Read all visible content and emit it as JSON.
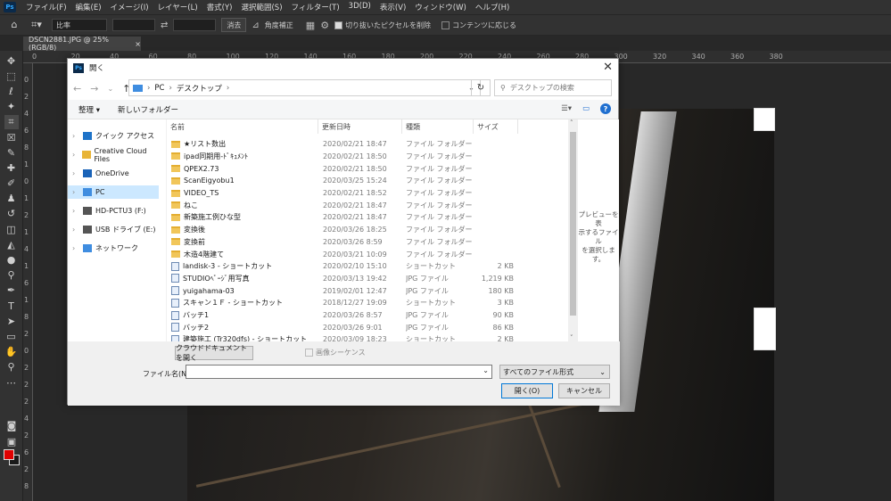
{
  "menu": [
    "ファイル(F)",
    "編集(E)",
    "イメージ(I)",
    "レイヤー(L)",
    "書式(Y)",
    "選択範囲(S)",
    "フィルター(T)",
    "3D(D)",
    "表示(V)",
    "ウィンドウ(W)",
    "ヘルプ(H)"
  ],
  "app_logo": "Ps",
  "options": {
    "ratio": "比率",
    "clear": "消去",
    "straighten": "角度補正",
    "delete_cropped": "切り抜いたピクセルを削除",
    "content_aware": "コンテンツに応じる"
  },
  "doc_tab": {
    "title": "DSCN2881.JPG @ 25% (RGB/8)",
    "close": "×"
  },
  "ruler_top": [
    "0",
    "20",
    "40",
    "60",
    "80",
    "100",
    "120",
    "140",
    "160",
    "180",
    "200",
    "220",
    "240",
    "260",
    "280",
    "300",
    "320",
    "340",
    "360",
    "380"
  ],
  "ruler_left": [
    "0",
    "2",
    "4",
    "6",
    "8",
    "1",
    "0",
    "1",
    "2",
    "1",
    "4",
    "1",
    "6",
    "1",
    "8",
    "2",
    "0",
    "2",
    "2",
    "2",
    "4",
    "2",
    "6",
    "2",
    "8"
  ],
  "dialog": {
    "title": "開く",
    "close": "✕",
    "address": [
      "PC",
      "デスクトップ"
    ],
    "search_placeholder": "デスクトップの検索",
    "organize": "整理 ▾",
    "new_folder": "新しいフォルダー",
    "nav": [
      {
        "label": "クイック アクセス",
        "icon": "star-icon",
        "color": "#1e73c8"
      },
      {
        "label": "Creative Cloud Files",
        "icon": "cloud-folder-icon",
        "color": "#e8b437"
      },
      {
        "label": "OneDrive",
        "icon": "onedrive-icon",
        "color": "#1a63b8"
      },
      {
        "label": "PC",
        "icon": "pc-icon",
        "color": "#3f8de0"
      },
      {
        "label": "HD-PCTU3 (F:)",
        "icon": "drive-icon",
        "color": "#555555"
      },
      {
        "label": "USB ドライブ (E:)",
        "icon": "usb-drive-icon",
        "color": "#555555"
      },
      {
        "label": "ネットワーク",
        "icon": "network-icon",
        "color": "#3f8de0"
      }
    ],
    "columns": {
      "name": "名前",
      "date": "更新日時",
      "type": "種類",
      "size": "サイズ"
    },
    "files": [
      {
        "name": "★リスト数出",
        "date": "2020/02/21 18:47",
        "type": "ファイル フォルダー",
        "size": "",
        "kind": "folder"
      },
      {
        "name": "ipad同期用-ﾄﾞｷｭﾒﾝﾄ",
        "date": "2020/02/21 18:50",
        "type": "ファイル フォルダー",
        "size": "",
        "kind": "folder"
      },
      {
        "name": "QPEX2.73",
        "date": "2020/02/21 18:50",
        "type": "ファイル フォルダー",
        "size": "",
        "kind": "folder"
      },
      {
        "name": "ScanEigyobu1",
        "date": "2020/03/25 15:24",
        "type": "ファイル フォルダー",
        "size": "",
        "kind": "folder"
      },
      {
        "name": "VIDEO_TS",
        "date": "2020/02/21 18:52",
        "type": "ファイル フォルダー",
        "size": "",
        "kind": "folder"
      },
      {
        "name": "ねこ",
        "date": "2020/02/21 18:47",
        "type": "ファイル フォルダー",
        "size": "",
        "kind": "folder"
      },
      {
        "name": "新築施工例ひな型",
        "date": "2020/02/21 18:47",
        "type": "ファイル フォルダー",
        "size": "",
        "kind": "folder"
      },
      {
        "name": "変換後",
        "date": "2020/03/26 18:25",
        "type": "ファイル フォルダー",
        "size": "",
        "kind": "folder"
      },
      {
        "name": "変換前",
        "date": "2020/03/26 8:59",
        "type": "ファイル フォルダー",
        "size": "",
        "kind": "folder"
      },
      {
        "name": "木造4階建て",
        "date": "2020/03/21 10:09",
        "type": "ファイル フォルダー",
        "size": "",
        "kind": "folder"
      },
      {
        "name": "landisk-3 - ショートカット",
        "date": "2020/02/10 15:10",
        "type": "ショートカット",
        "size": "2 KB",
        "kind": "file"
      },
      {
        "name": "STUDIOﾍﾟｰｼﾞ用写真",
        "date": "2020/03/13 19:42",
        "type": "JPG ファイル",
        "size": "1,219 KB",
        "kind": "file"
      },
      {
        "name": "yuigahama-03",
        "date": "2019/02/01 12:47",
        "type": "JPG ファイル",
        "size": "180 KB",
        "kind": "file"
      },
      {
        "name": "スキャン１Ｆ - ショートカット",
        "date": "2018/12/27 19:09",
        "type": "ショートカット",
        "size": "3 KB",
        "kind": "file"
      },
      {
        "name": "バッチ1",
        "date": "2020/03/26 8:57",
        "type": "JPG ファイル",
        "size": "90 KB",
        "kind": "file"
      },
      {
        "name": "バッチ2",
        "date": "2020/03/26 9:01",
        "type": "JPG ファイル",
        "size": "86 KB",
        "kind": "file"
      },
      {
        "name": "建築施工 (Tr320dfs) - ショートカット",
        "date": "2020/03/09 18:23",
        "type": "ショートカット",
        "size": "2 KB",
        "kind": "file"
      }
    ],
    "preview": [
      "プレビューを表",
      "示するファイル",
      "を選択しま",
      "す。"
    ],
    "cloud_btn": "クラウドドキュメントを開く",
    "image_sequence": "画像シーケンス",
    "filename_label": "ファイル名(N):",
    "filename_value": "",
    "filetype": "すべてのファイル形式",
    "open_btn": "開く(O)",
    "cancel_btn": "キャンセル"
  }
}
